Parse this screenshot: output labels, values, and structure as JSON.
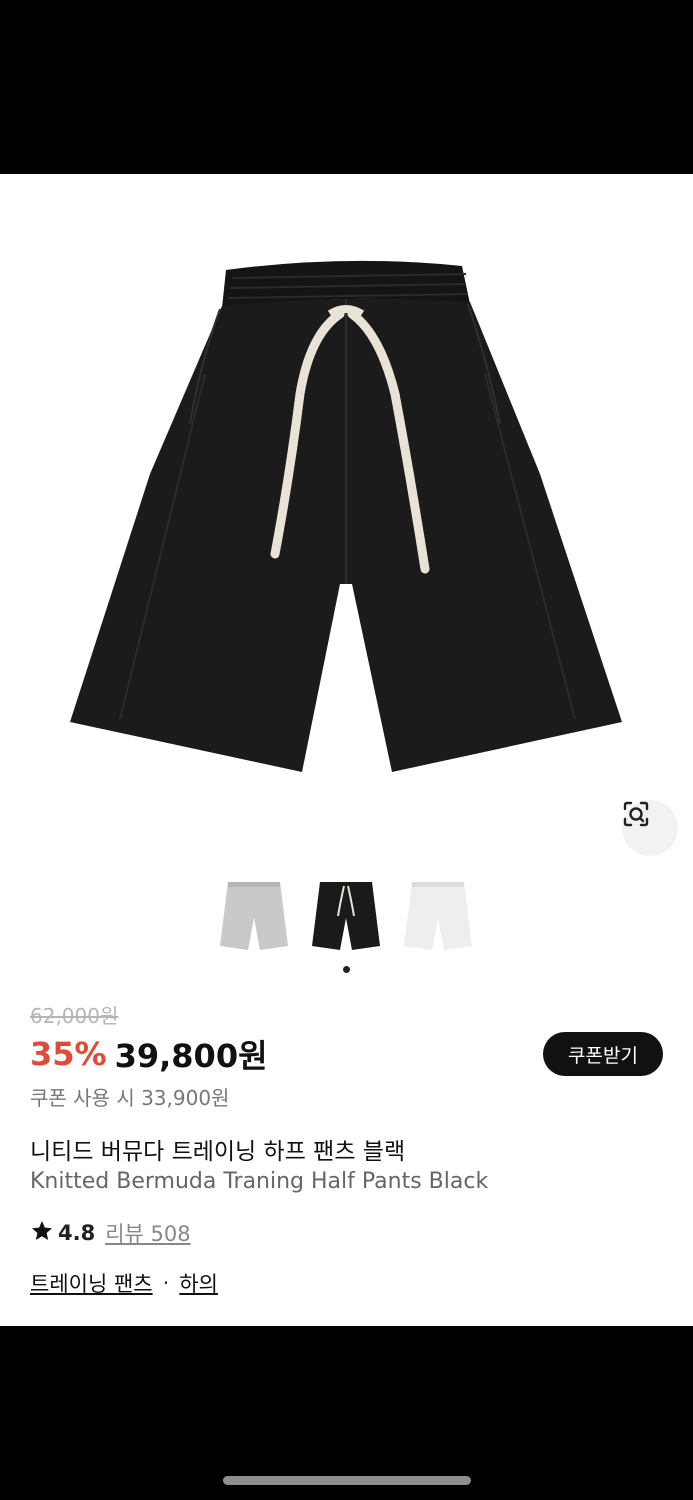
{
  "product": {
    "original_price": "62,000원",
    "discount": "35%",
    "price": "39,800원",
    "coupon_button": "쿠폰받기",
    "coupon_price": "쿠폰 사용 시 33,900원",
    "title_ko": "니티드 버뮤다 트레이닝 하프 팬츠 블랙",
    "title_en": "Knitted Bermuda Traning Half Pants Black",
    "rating": "4.8",
    "review_label": "리뷰 508",
    "category_1": "트레이닝 팬츠",
    "separator": "·",
    "category_2": "하의"
  },
  "gallery": {
    "thumbnails": [
      {
        "name": "gray",
        "color": "#c9c9c9"
      },
      {
        "name": "black",
        "color": "#1a1a1a"
      },
      {
        "name": "white",
        "color": "#eeeeef"
      }
    ],
    "selected_index": 1,
    "lens_icon": "visual-search-icon"
  },
  "colors": {
    "accent": "#e04b38",
    "button_bg": "#111111"
  }
}
